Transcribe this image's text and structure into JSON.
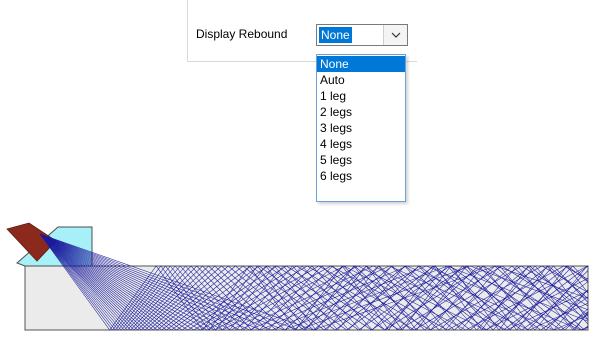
{
  "rebound": {
    "label": "Display Rebound",
    "selected": "None",
    "options": [
      "None",
      "Auto",
      "1 leg",
      "2 legs",
      "3 legs",
      "4 legs",
      "5 legs",
      "6 legs"
    ],
    "selected_index": 0
  },
  "colors": {
    "selection": "#0078d7",
    "ray": "#1c1c9c",
    "probe_wedge": "#a8f0f8",
    "transducer": "#8b2a1c",
    "specimen": "#ebebeb"
  }
}
